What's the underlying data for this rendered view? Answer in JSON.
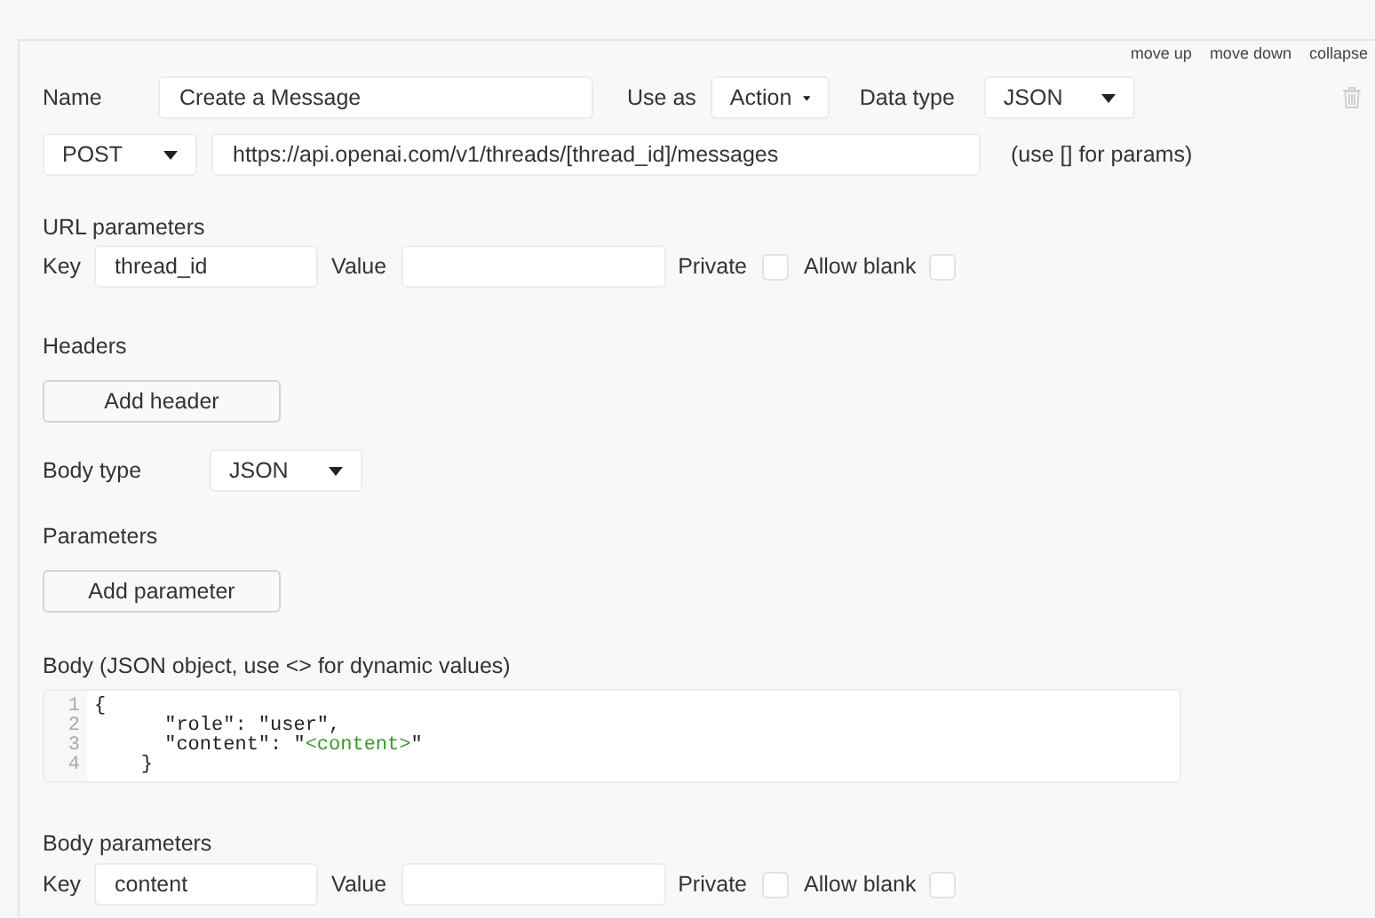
{
  "links": [
    "move up",
    "move down",
    "collapse"
  ],
  "name": {
    "label": "Name",
    "value": "Create a Message"
  },
  "use_as": {
    "label": "Use as",
    "value": "Action"
  },
  "data_type": {
    "label": "Data type",
    "value": "JSON"
  },
  "method": {
    "value": "POST"
  },
  "url": {
    "value": "https://api.openai.com/v1/threads/[thread_id]/messages",
    "hint": "(use [] for params)"
  },
  "url_parameters": {
    "title": "URL parameters",
    "rows": [
      {
        "key_label": "Key",
        "key": "thread_id",
        "value_label": "Value",
        "value": "",
        "private_label": "Private",
        "private": false,
        "allow_blank_label": "Allow blank",
        "allow_blank": false
      }
    ]
  },
  "headers": {
    "title": "Headers",
    "button": "Add header"
  },
  "body_type": {
    "label": "Body type",
    "value": "JSON"
  },
  "parameters": {
    "title": "Parameters",
    "button": "Add parameter"
  },
  "body": {
    "title": "Body (JSON object, use <> for dynamic values)",
    "lines": [
      {
        "number": "1",
        "tokens": [
          {
            "kind": "plain",
            "text": "{"
          }
        ]
      },
      {
        "number": "2",
        "tokens": [
          {
            "kind": "plain",
            "text": "      \"role\": \"user\","
          }
        ]
      },
      {
        "number": "3",
        "tokens": [
          {
            "kind": "plain",
            "text": "      \"content\": \""
          },
          {
            "kind": "dynamic",
            "text": "<content>"
          },
          {
            "kind": "plain",
            "text": "\""
          }
        ]
      },
      {
        "number": "4",
        "tokens": [
          {
            "kind": "plain",
            "text": "    }"
          }
        ]
      }
    ]
  },
  "body_parameters": {
    "title": "Body parameters",
    "rows": [
      {
        "key_label": "Key",
        "key": "content",
        "value_label": "Value",
        "value": "",
        "private_label": "Private",
        "private": false,
        "allow_blank_label": "Allow blank",
        "allow_blank": false
      }
    ]
  }
}
